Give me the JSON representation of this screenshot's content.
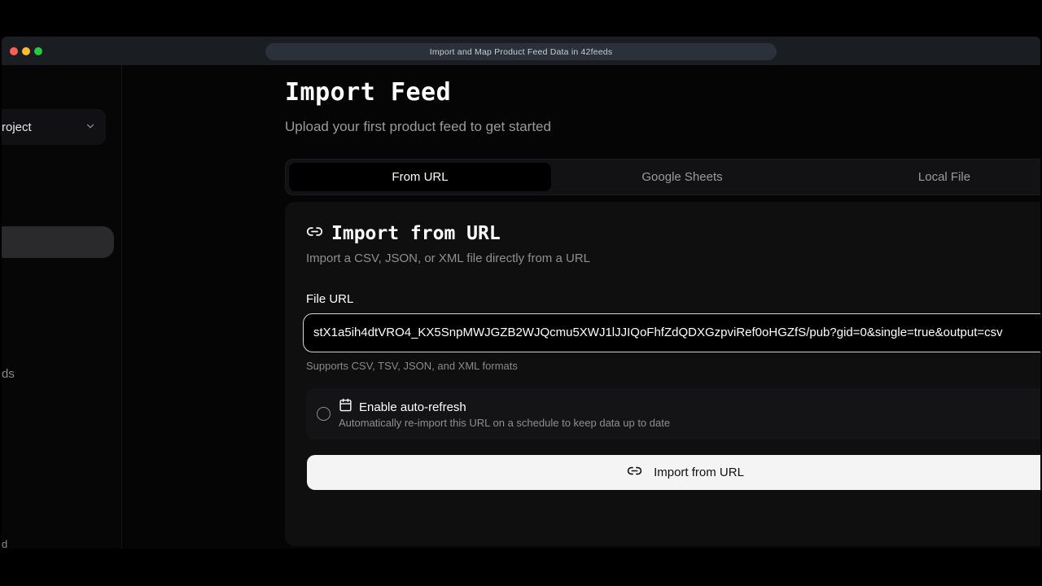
{
  "window": {
    "title": "Import and Map Product Feed Data in 42feeds"
  },
  "sidebar": {
    "project_label": "roject",
    "nav_fragment": "ds",
    "bottom_fragment": "d"
  },
  "page": {
    "title": "Import Feed",
    "subtitle": "Upload your first product feed to get started"
  },
  "tabs": [
    {
      "label": "From URL",
      "active": true
    },
    {
      "label": "Google Sheets",
      "active": false
    },
    {
      "label": "Local File",
      "active": false
    }
  ],
  "card": {
    "title": "Import from URL",
    "subtitle": "Import a CSV, JSON, or XML file directly from a URL",
    "field_label": "File URL",
    "url_value": "stX1a5ih4dtVRO4_KX5SnpMWJGZB2WJQcmu5XWJ1lJJIQoFhfZdQDXGzpviRef0oHGZfS/pub?gid=0&single=true&output=csv",
    "helper": "Supports CSV, TSV, JSON, and XML formats",
    "auto_refresh": {
      "title": "Enable auto-refresh",
      "description": "Automatically re-import this URL on a schedule to keep data up to date",
      "checked": false
    },
    "button_label": "Import from URL"
  },
  "colors": {
    "background": "#000000",
    "card": "#0f0f10",
    "button": "#f4f4f4",
    "active_tab": "#000000"
  },
  "icons": [
    "link-icon",
    "calendar-icon",
    "chevron-down-icon"
  ]
}
